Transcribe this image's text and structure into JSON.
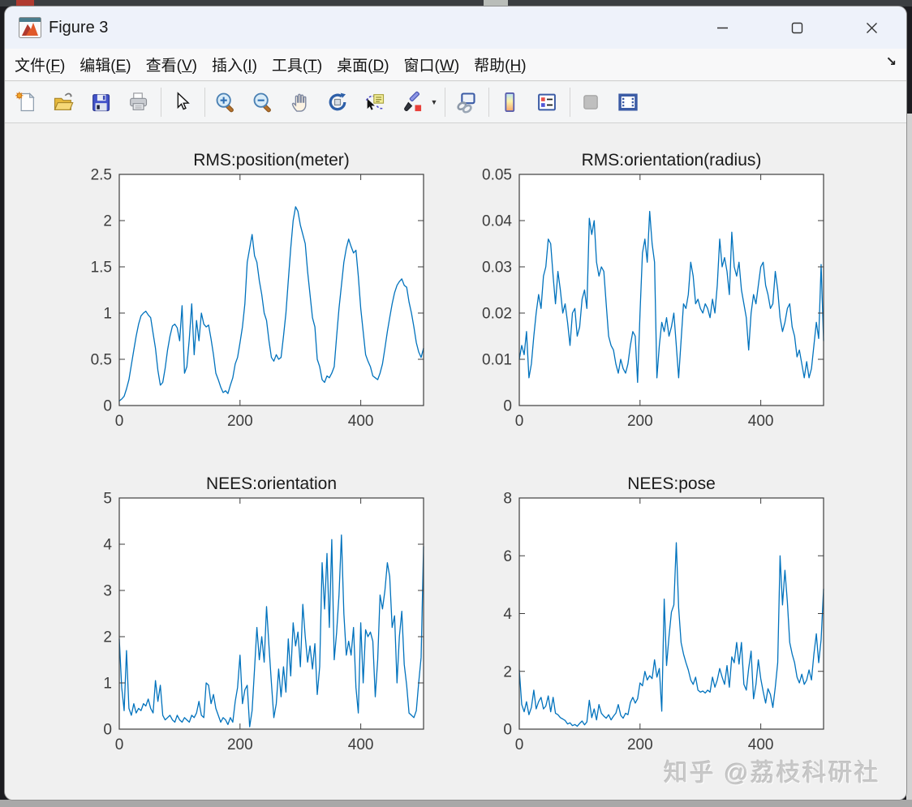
{
  "window": {
    "title": "Figure 3",
    "controls": [
      "minimize",
      "maximize",
      "close"
    ]
  },
  "menu": {
    "items": [
      {
        "pre": "文件(",
        "key": "F",
        "post": ")"
      },
      {
        "pre": "编辑(",
        "key": "E",
        "post": ")"
      },
      {
        "pre": "查看(",
        "key": "V",
        "post": ")"
      },
      {
        "pre": "插入(",
        "key": "I",
        "post": ")"
      },
      {
        "pre": "工具(",
        "key": "T",
        "post": ")"
      },
      {
        "pre": "桌面(",
        "key": "D",
        "post": ")"
      },
      {
        "pre": "窗口(",
        "key": "W",
        "post": ")"
      },
      {
        "pre": "帮助(",
        "key": "H",
        "post": ")"
      }
    ],
    "overflow_arrow": "↘"
  },
  "toolbar": {
    "buttons": [
      "new-figure",
      "open-file",
      "save-figure",
      "print-figure",
      "edit-plot-pointer",
      "zoom-in",
      "zoom-out",
      "pan",
      "rotate-3d",
      "data-cursor",
      "brush-data",
      "link-plot",
      "insert-colorbar",
      "insert-legend",
      "disabled-tool",
      "dock-figure"
    ],
    "brush_dropdown": "▼"
  },
  "watermark": {
    "text": "知乎 @荔枝科研社"
  },
  "colors": {
    "line": "#0072BD",
    "axes_box": "#3e3e3e",
    "figure_bg": "#f0f0f0",
    "titlebar_bg": "#eef2fa"
  },
  "chart_data": [
    {
      "type": "line",
      "title": "RMS:position(meter)",
      "xlabel": "",
      "ylabel": "",
      "xlim": [
        0,
        504
      ],
      "ylim": [
        0,
        2.5
      ],
      "xticks": [
        0,
        200,
        400
      ],
      "yticks": [
        0,
        0.5,
        1,
        1.5,
        2,
        2.5
      ],
      "grid": false,
      "line_color": "#0072BD",
      "x_start": 0,
      "x_step": 4,
      "values": [
        0.05,
        0.07,
        0.1,
        0.18,
        0.28,
        0.44,
        0.6,
        0.75,
        0.88,
        0.97,
        1.0,
        1.02,
        0.98,
        0.95,
        0.78,
        0.62,
        0.38,
        0.22,
        0.25,
        0.4,
        0.6,
        0.75,
        0.86,
        0.88,
        0.84,
        0.7,
        1.08,
        0.35,
        0.42,
        0.72,
        1.1,
        0.55,
        0.92,
        0.7,
        1.0,
        0.88,
        0.85,
        0.87,
        0.72,
        0.55,
        0.35,
        0.28,
        0.2,
        0.14,
        0.16,
        0.13,
        0.22,
        0.3,
        0.45,
        0.52,
        0.68,
        0.85,
        1.1,
        1.55,
        1.7,
        1.85,
        1.62,
        1.55,
        1.35,
        1.2,
        1.0,
        0.92,
        0.7,
        0.52,
        0.48,
        0.55,
        0.5,
        0.52,
        0.75,
        1.0,
        1.35,
        1.7,
        2.0,
        2.15,
        2.1,
        1.95,
        1.85,
        1.75,
        1.45,
        1.2,
        0.95,
        0.85,
        0.5,
        0.42,
        0.28,
        0.25,
        0.32,
        0.3,
        0.35,
        0.42,
        0.75,
        1.05,
        1.3,
        1.55,
        1.7,
        1.8,
        1.72,
        1.65,
        1.68,
        1.4,
        1.05,
        0.8,
        0.55,
        0.48,
        0.42,
        0.32,
        0.3,
        0.28,
        0.35,
        0.45,
        0.62,
        0.8,
        0.95,
        1.1,
        1.22,
        1.3,
        1.34,
        1.37,
        1.3,
        1.28,
        1.12,
        1.0,
        0.85,
        0.68,
        0.58,
        0.52,
        0.62
      ]
    },
    {
      "type": "line",
      "title": "RMS:orientation(radius)",
      "xlabel": "",
      "ylabel": "",
      "xlim": [
        0,
        504
      ],
      "ylim": [
        0,
        0.05
      ],
      "xticks": [
        0,
        200,
        400
      ],
      "yticks": [
        0,
        0.01,
        0.02,
        0.03,
        0.04,
        0.05
      ],
      "grid": false,
      "line_color": "#0072BD",
      "x_start": 0,
      "x_step": 4,
      "values": [
        0.01,
        0.013,
        0.011,
        0.016,
        0.006,
        0.009,
        0.015,
        0.02,
        0.024,
        0.021,
        0.028,
        0.03,
        0.036,
        0.035,
        0.028,
        0.022,
        0.029,
        0.025,
        0.02,
        0.022,
        0.018,
        0.013,
        0.02,
        0.021,
        0.015,
        0.017,
        0.023,
        0.025,
        0.021,
        0.0405,
        0.037,
        0.04,
        0.031,
        0.028,
        0.03,
        0.029,
        0.022,
        0.015,
        0.013,
        0.012,
        0.009,
        0.007,
        0.01,
        0.008,
        0.007,
        0.009,
        0.013,
        0.016,
        0.015,
        0.005,
        0.02,
        0.033,
        0.036,
        0.031,
        0.042,
        0.035,
        0.031,
        0.006,
        0.013,
        0.018,
        0.016,
        0.019,
        0.015,
        0.017,
        0.02,
        0.013,
        0.006,
        0.014,
        0.022,
        0.021,
        0.024,
        0.031,
        0.028,
        0.022,
        0.023,
        0.021,
        0.02,
        0.022,
        0.021,
        0.019,
        0.023,
        0.02,
        0.026,
        0.036,
        0.03,
        0.032,
        0.029,
        0.024,
        0.0375,
        0.03,
        0.028,
        0.031,
        0.025,
        0.022,
        0.019,
        0.012,
        0.02,
        0.024,
        0.022,
        0.026,
        0.03,
        0.031,
        0.026,
        0.024,
        0.021,
        0.022,
        0.029,
        0.025,
        0.019,
        0.016,
        0.018,
        0.021,
        0.022,
        0.017,
        0.015,
        0.0105,
        0.012,
        0.009,
        0.006,
        0.0095,
        0.006,
        0.008,
        0.013,
        0.018,
        0.0145,
        0.0305,
        0.014
      ]
    },
    {
      "type": "line",
      "title": "NEES:orientation",
      "xlabel": "",
      "ylabel": "",
      "xlim": [
        0,
        504
      ],
      "ylim": [
        0,
        5
      ],
      "xticks": [
        0,
        200,
        400
      ],
      "yticks": [
        0,
        1,
        2,
        3,
        4,
        5
      ],
      "grid": false,
      "line_color": "#0072BD",
      "x_start": 0,
      "x_step": 4,
      "values": [
        1.95,
        0.9,
        0.4,
        1.7,
        0.45,
        0.3,
        0.55,
        0.35,
        0.45,
        0.4,
        0.55,
        0.5,
        0.65,
        0.45,
        0.35,
        1.05,
        0.6,
        0.95,
        0.3,
        0.2,
        0.25,
        0.3,
        0.2,
        0.15,
        0.3,
        0.2,
        0.15,
        0.25,
        0.2,
        0.15,
        0.3,
        0.25,
        0.35,
        0.6,
        0.3,
        0.25,
        1.0,
        0.95,
        0.55,
        0.75,
        0.45,
        0.3,
        0.15,
        0.25,
        0.2,
        0.1,
        0.25,
        0.15,
        0.6,
        0.9,
        1.6,
        0.55,
        0.85,
        0.95,
        0.05,
        0.4,
        1.3,
        2.2,
        1.5,
        2.0,
        1.45,
        2.65,
        1.8,
        1.0,
        0.25,
        0.55,
        1.3,
        0.7,
        1.35,
        0.8,
        1.95,
        1.15,
        2.3,
        1.8,
        2.1,
        1.35,
        2.7,
        2.0,
        1.45,
        1.8,
        1.3,
        1.85,
        0.75,
        1.35,
        3.6,
        2.6,
        3.8,
        2.2,
        4.1,
        1.5,
        2.1,
        2.9,
        4.2,
        2.5,
        1.6,
        1.9,
        1.6,
        2.2,
        0.9,
        0.35,
        2.3,
        1.0,
        2.15,
        2.0,
        2.1,
        1.9,
        0.7,
        1.5,
        2.9,
        2.6,
        3.0,
        3.6,
        3.3,
        2.2,
        2.45,
        1.0,
        2.0,
        2.55,
        1.4,
        0.95,
        0.35,
        0.3,
        0.25,
        0.4,
        1.0,
        1.55,
        3.95
      ]
    },
    {
      "type": "line",
      "title": "NEES:pose",
      "xlabel": "",
      "ylabel": "",
      "xlim": [
        0,
        504
      ],
      "ylim": [
        0,
        8
      ],
      "xticks": [
        0,
        200,
        400
      ],
      "yticks": [
        0,
        2,
        4,
        6,
        8
      ],
      "grid": false,
      "line_color": "#0072BD",
      "x_start": 0,
      "x_step": 4,
      "values": [
        2.05,
        0.85,
        0.6,
        0.95,
        0.5,
        0.75,
        1.35,
        0.7,
        0.95,
        1.1,
        0.7,
        0.8,
        1.15,
        0.6,
        1.1,
        0.55,
        0.5,
        0.4,
        0.35,
        0.3,
        0.18,
        0.22,
        0.12,
        0.16,
        0.1,
        0.2,
        0.28,
        0.15,
        0.25,
        1.0,
        0.4,
        0.7,
        0.32,
        0.85,
        0.55,
        0.45,
        0.38,
        0.5,
        0.32,
        0.45,
        0.55,
        0.85,
        0.48,
        0.38,
        0.55,
        0.5,
        0.92,
        1.1,
        0.9,
        1.05,
        1.6,
        1.5,
        2.0,
        1.7,
        1.85,
        1.75,
        2.4,
        1.8,
        2.1,
        0.62,
        4.5,
        2.2,
        3.2,
        4.05,
        4.3,
        6.45,
        4.2,
        3.0,
        2.6,
        2.3,
        2.05,
        1.7,
        1.55,
        1.8,
        1.35,
        1.28,
        1.32,
        1.25,
        1.35,
        1.28,
        1.8,
        1.45,
        1.7,
        2.1,
        1.8,
        1.55,
        2.2,
        1.45,
        2.5,
        2.3,
        3.0,
        2.25,
        3.0,
        1.55,
        1.35,
        2.1,
        2.7,
        1.05,
        1.55,
        2.4,
        1.75,
        1.3,
        0.9,
        1.4,
        1.2,
        0.75,
        1.45,
        2.3,
        6.0,
        4.3,
        5.5,
        4.4,
        3.0,
        2.6,
        2.3,
        1.8,
        1.6,
        1.9,
        1.55,
        1.7,
        2.05,
        1.7,
        2.6,
        3.3,
        2.3,
        3.1,
        4.85
      ]
    }
  ]
}
